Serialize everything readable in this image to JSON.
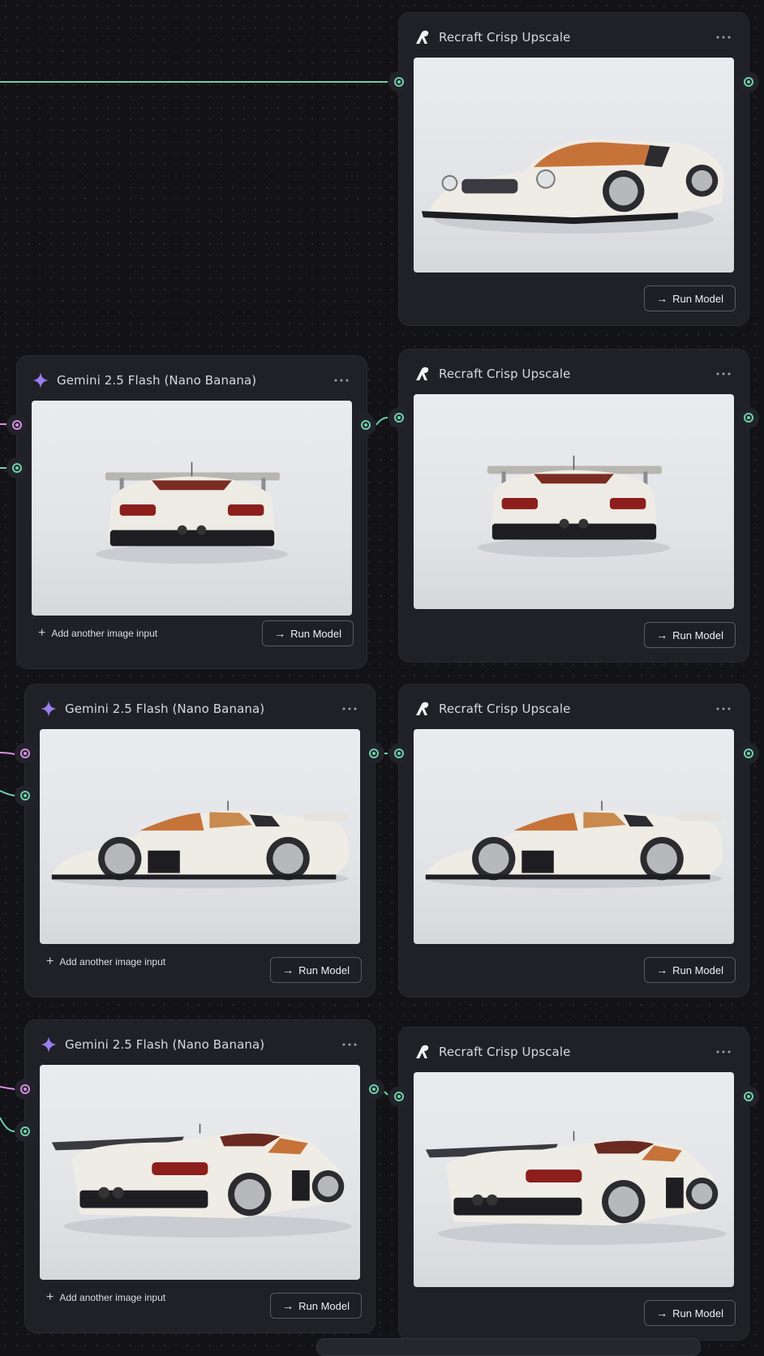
{
  "colors": {
    "canvas_bg": "#121217",
    "node_bg": "#202027",
    "wire_green": "#6fd0a9",
    "wire_pink": "#d88ee0",
    "gemini_accent": "#9b7df0"
  },
  "upscale_nodes": [
    {
      "title": "Recraft Crisp Upscale",
      "run_label": "Run Model",
      "menu_icon": "ellipsis-icon",
      "brand_icon": "recraft-logo-icon",
      "image": "white race car, front three-quarter view"
    },
    {
      "title": "Recraft Crisp Upscale",
      "run_label": "Run Model",
      "menu_icon": "ellipsis-icon",
      "brand_icon": "recraft-logo-icon",
      "image": "white race car, rear view"
    },
    {
      "title": "Recraft Crisp Upscale",
      "run_label": "Run Model",
      "menu_icon": "ellipsis-icon",
      "brand_icon": "recraft-logo-icon",
      "image": "white race car, side profile"
    },
    {
      "title": "Recraft Crisp Upscale",
      "run_label": "Run Model",
      "menu_icon": "ellipsis-icon",
      "brand_icon": "recraft-logo-icon",
      "image": "white race car, rear three-quarter view"
    }
  ],
  "gemini_nodes": [
    {
      "title": "Gemini 2.5 Flash (Nano Banana)",
      "add_input_label": "Add another image input",
      "run_label": "Run Model",
      "menu_icon": "ellipsis-icon",
      "brand_icon": "gemini-sparkle-icon",
      "image": "white race car, rear view"
    },
    {
      "title": "Gemini 2.5 Flash (Nano Banana)",
      "add_input_label": "Add another image input",
      "run_label": "Run Model",
      "menu_icon": "ellipsis-icon",
      "brand_icon": "gemini-sparkle-icon",
      "image": "white race car, side profile"
    },
    {
      "title": "Gemini 2.5 Flash (Nano Banana)",
      "add_input_label": "Add another image input",
      "run_label": "Run Model",
      "menu_icon": "ellipsis-icon",
      "brand_icon": "gemini-sparkle-icon",
      "image": "white race car, rear three-quarter view"
    }
  ]
}
